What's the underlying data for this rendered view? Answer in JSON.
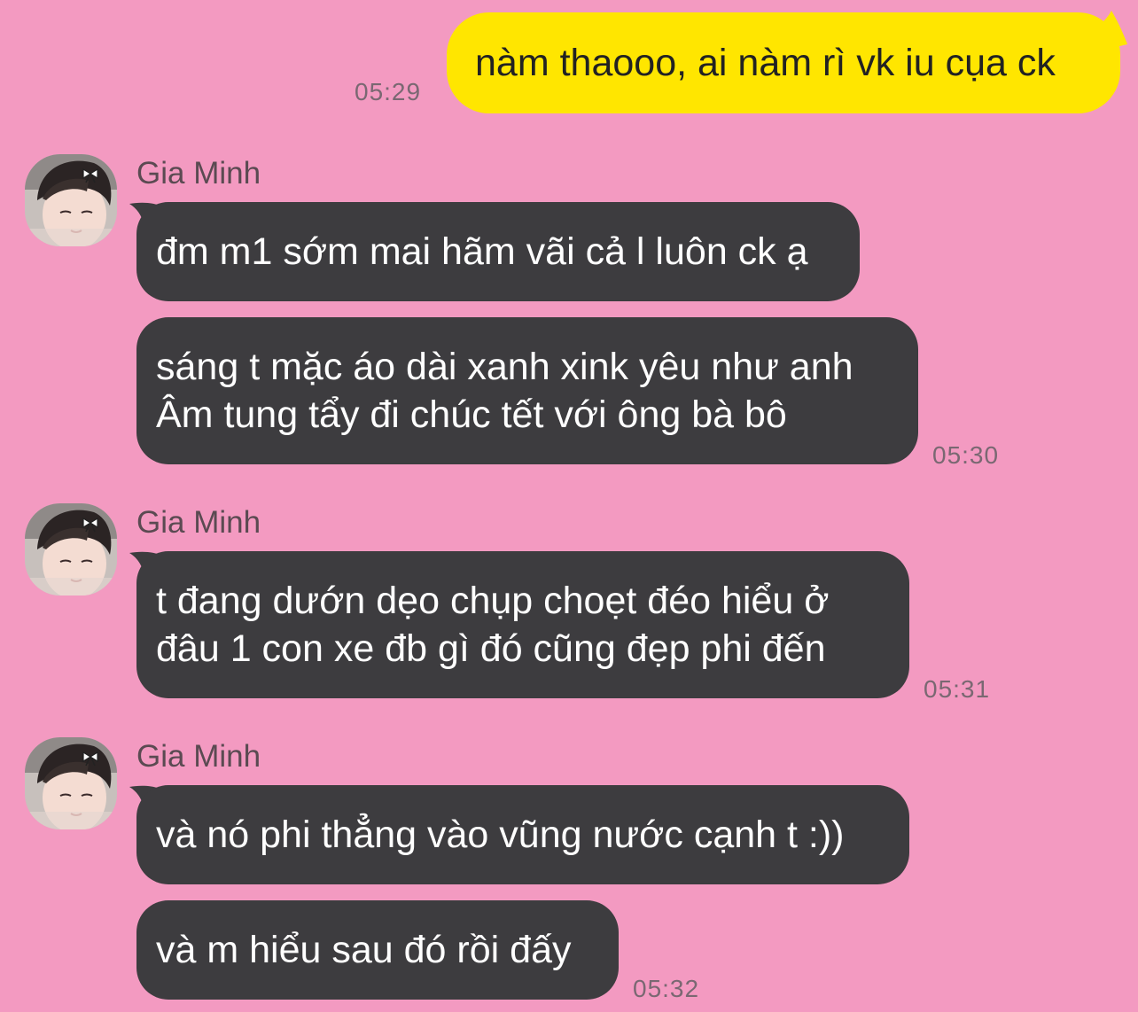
{
  "chat": {
    "outgoing": [
      {
        "text": "nàm thaooo, ai nàm rì vk iu cụa ck",
        "time": "05:29"
      }
    ],
    "groups": [
      {
        "sender": "Gia Minh",
        "messages": [
          "đm m1 sớm mai hãm vãi cả l luôn ck ạ",
          "sáng t mặc áo dài xanh xink yêu như anh\nÂm tung tẩy đi chúc tết với ông bà bô"
        ],
        "time": "05:30"
      },
      {
        "sender": "Gia Minh",
        "messages": [
          "t đang dướn dẹo chụp choẹt đéo hiểu ở\nđâu 1 con xe đb gì đó cũng đẹp phi đến"
        ],
        "time": "05:31"
      },
      {
        "sender": "Gia Minh",
        "messages": [
          "và nó phi thẳng vào vũng nước cạnh t :))",
          "và m hiểu sau đó rồi đấy"
        ],
        "time": "05:32"
      }
    ]
  },
  "colors": {
    "background": "#f39ac1",
    "outgoing_bubble": "#ffe600",
    "incoming_bubble": "#3d3c3f",
    "incoming_text": "#ffffff",
    "outgoing_text": "#222222"
  },
  "icons": {
    "avatar": "profile-photo"
  }
}
